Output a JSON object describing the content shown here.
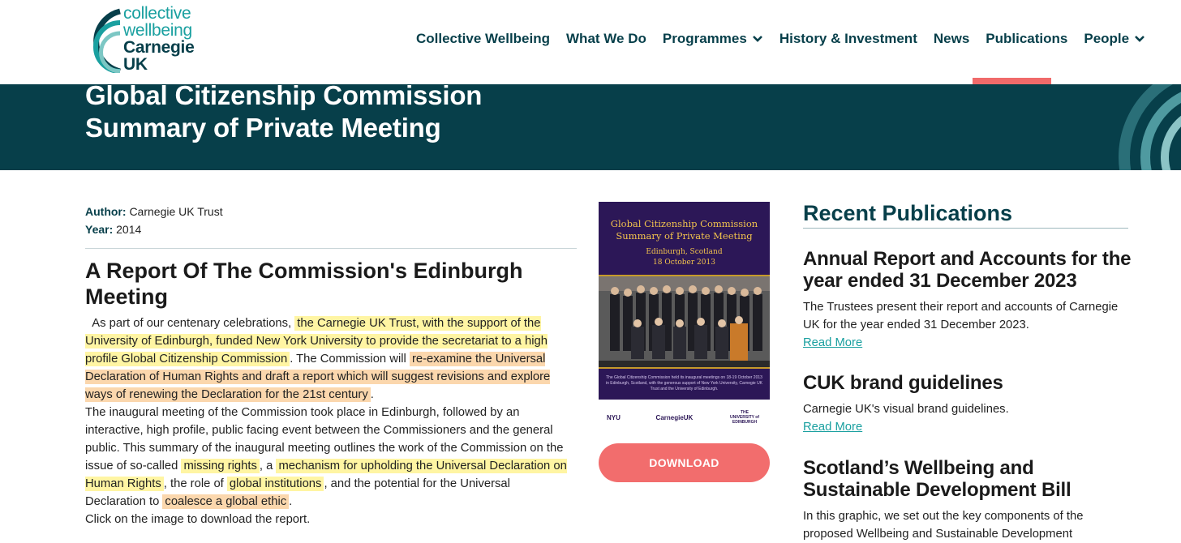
{
  "logo": {
    "line1": "collective",
    "line2": "wellbeing",
    "line3": "Carnegie",
    "line4": "UK"
  },
  "nav": [
    {
      "label": "Collective Wellbeing"
    },
    {
      "label": "What We Do"
    },
    {
      "label": "Programmes",
      "icon": "chevron-down-icon"
    },
    {
      "label": "History & Investment"
    },
    {
      "label": "News"
    },
    {
      "label": "Publications",
      "active": true
    },
    {
      "label": "People",
      "icon": "chevron-down-icon"
    }
  ],
  "banner": {
    "title_line1": "Global Citizenship Commission",
    "title_line2": "Summary of Private Meeting"
  },
  "meta": {
    "author_label": "Author:",
    "author": "Carnegie UK Trust",
    "year_label": "Year:",
    "year": "2014"
  },
  "report": {
    "title": "A Report Of The Commission's Edinburgh Meeting",
    "p1_a": "As part of our centenary celebrations,",
    "p1_hl1": "the Carnegie UK Trust, with the support of the University of Edinburgh, funded New York University to provide the secretariat to a high profile Global Citizenship Commission",
    "p1_b": ". The Commission will",
    "p1_hl2": "re-examine the Universal Declaration of Human Rights and draft a report which will suggest revisions and explore ways of renewing the Declaration for the 21st century",
    "p1_c": ".",
    "p2_a": "The inaugural meeting of the Commission took place in Edinburgh, followed by an interactive, high profile, public facing event between the Commissioners and the general public. This summary of the inaugural meeting outlines the work of the Commission on the issue of so-called",
    "p2_hl1": "missing rights",
    "p2_b": ", a",
    "p2_hl2": "mechanism for upholding the Universal Declaration on Human Rights",
    "p2_c": ", the role of",
    "p2_hl3": "global institutions",
    "p2_d": ", and the potential for the Universal Declaration to",
    "p2_hl4": "coalesce a global ethic",
    "p2_e": ".",
    "p3": "Click on the image to download the report."
  },
  "cover": {
    "title_line1": "Global Citizenship Commission",
    "title_line2": "Summary of Private Meeting",
    "place": "Edinburgh, Scotland",
    "date": "18 October 2013",
    "footnote": "The Global Citizenship Commission held its inaugural meetings on 18-19 October 2013 in Edinburgh, Scotland, with the generous support of New York University, Carnegie UK Trust and the University of Edinburgh.",
    "logo1": "NYU",
    "logo2": "CarnegieUK",
    "logo3": "THE UNIVERSITY of EDINBURGH"
  },
  "download": {
    "label": "DOWNLOAD"
  },
  "sidebar": {
    "heading": "Recent Publications",
    "items": [
      {
        "title": "Annual Report and Accounts for the year ended 31 December 2023",
        "desc": "The Trustees present their report and accounts of Carnegie UK for the year ended 31 December 2023.",
        "link": "Read More"
      },
      {
        "title": "CUK brand guidelines",
        "desc": "Carnegie UK's visual brand guidelines.",
        "link": "Read More"
      },
      {
        "title": "Scotland’s Wellbeing and Sustainable Development Bill",
        "desc": "In this graphic, we set out the key components of the proposed Wellbeing and Sustainable Development"
      }
    ]
  },
  "colors": {
    "brand_dark": "#073f4a",
    "brand_teal": "#1aa0a0",
    "accent": "#f26d6d",
    "highlight_yellow": "#fff5a3",
    "highlight_orange": "#fbd7ad"
  }
}
